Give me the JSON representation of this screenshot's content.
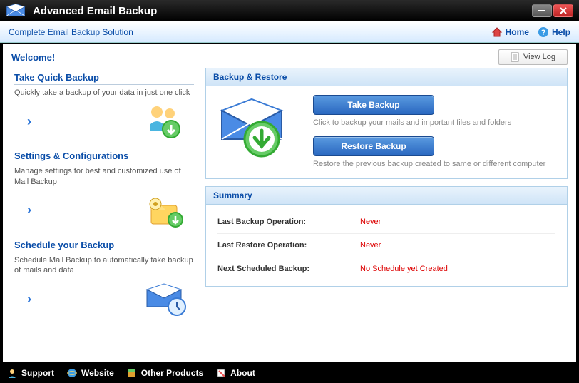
{
  "title": "Advanced Email Backup",
  "tagline": "Complete Email Backup Solution",
  "header_links": {
    "home": "Home",
    "help": "Help"
  },
  "welcome": "Welcome!",
  "view_log": "View Log",
  "left_sections": [
    {
      "title": "Take Quick Backup",
      "desc": "Quickly take a backup of your data in just one click"
    },
    {
      "title": "Settings & Configurations",
      "desc": "Manage settings for best and customized use of Mail Backup"
    },
    {
      "title": "Schedule your Backup",
      "desc": "Schedule Mail Backup to automatically take backup of mails and data"
    }
  ],
  "panels": {
    "backup_restore": {
      "title": "Backup & Restore",
      "take": {
        "label": "Take Backup",
        "desc": "Click to backup your mails and important files and folders"
      },
      "restore": {
        "label": "Restore Backup",
        "desc": "Restore the previous backup created to same or different computer"
      }
    },
    "summary": {
      "title": "Summary",
      "rows": [
        {
          "label": "Last Backup Operation:",
          "value": "Never"
        },
        {
          "label": "Last Restore Operation:",
          "value": "Never"
        },
        {
          "label": "Next Scheduled Backup:",
          "value": "No Schedule yet Created"
        }
      ]
    }
  },
  "footer": {
    "support": "Support",
    "website": "Website",
    "other": "Other Products",
    "about": "About"
  }
}
